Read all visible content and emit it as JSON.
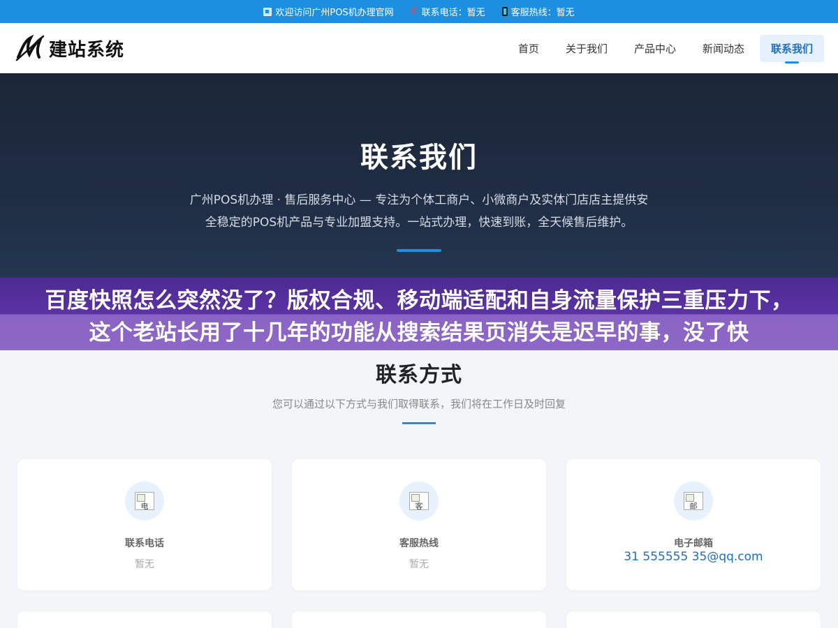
{
  "topbar": {
    "welcome": "欢迎访问广州POS机办理官网",
    "phone": "联系电话：暂无",
    "hotline": "客服热线：暂无"
  },
  "header": {
    "logo_text": "建站系统",
    "nav": [
      {
        "label": "首页",
        "active": false
      },
      {
        "label": "关于我们",
        "active": false
      },
      {
        "label": "产品中心",
        "active": false
      },
      {
        "label": "新闻动态",
        "active": false
      },
      {
        "label": "联系我们",
        "active": true
      }
    ]
  },
  "hero": {
    "title": "联系我们",
    "description": "广州POS机办理 · 售后服务中心 — 专注为个体工商户、小微商户及实体门店店主提供安全稳定的POS机产品与专业加盟支持。一站式办理，快速到账，全天候售后维护。"
  },
  "overlay": {
    "text": "百度快照怎么突然没了？版权合规、移动端适配和自身流量保护三重压力下，这个老站长用了十几年的功能从搜索结果页消失是迟早的事，没了快"
  },
  "contact": {
    "title": "联系方式",
    "subtitle": "您可以通过以下方式与我们取得联系，我们将在工作日及时回复",
    "cards": [
      {
        "icon_alt": "电",
        "label": "联系电话",
        "value": "暂无"
      },
      {
        "icon_alt": "客",
        "label": "客服热线",
        "value": "暂无"
      },
      {
        "icon_alt": "邮",
        "label": "电子邮箱",
        "value": "31 555555 35@qq.com"
      }
    ]
  },
  "colors": {
    "accent": "#1d8fe0",
    "hero_bg": "#1f2d44",
    "overlay_bg": "#5b33a3"
  }
}
